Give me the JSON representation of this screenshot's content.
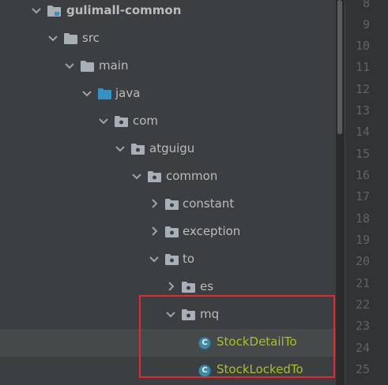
{
  "tree": {
    "nodes": [
      {
        "label": "gulimall-common",
        "expanded": true,
        "icon": "module-folder-icon",
        "bold": true
      },
      {
        "label": "src",
        "expanded": true,
        "icon": "folder-icon"
      },
      {
        "label": "main",
        "expanded": true,
        "icon": "folder-icon"
      },
      {
        "label": "java",
        "expanded": true,
        "icon": "source-root-folder-icon"
      },
      {
        "label": "com",
        "expanded": true,
        "icon": "package-icon"
      },
      {
        "label": "atguigu",
        "expanded": true,
        "icon": "package-icon"
      },
      {
        "label": "common",
        "expanded": true,
        "icon": "package-icon"
      },
      {
        "label": "constant",
        "expanded": false,
        "icon": "package-icon"
      },
      {
        "label": "exception",
        "expanded": false,
        "icon": "package-icon"
      },
      {
        "label": "to",
        "expanded": true,
        "icon": "package-icon"
      },
      {
        "label": "es",
        "expanded": false,
        "icon": "package-icon"
      },
      {
        "label": "mq",
        "expanded": true,
        "icon": "package-icon"
      },
      {
        "label": "StockDetailTo",
        "icon": "class-icon",
        "selected": true
      },
      {
        "label": "StockLockedTo",
        "icon": "class-icon"
      }
    ]
  },
  "class_icon_letter": "C",
  "line_numbers": [
    "8",
    "9",
    "10",
    "11",
    "12",
    "13",
    "14",
    "15",
    "16",
    "17",
    "18",
    "19",
    "20",
    "21",
    "22",
    "23",
    "24",
    "25"
  ],
  "colors": {
    "tree_bg": "#3c3f41",
    "editor_bg": "#2b2b2b",
    "text": "#bbbbbb",
    "class_text": "#a8c023",
    "highlight": "#45494a",
    "callout": "#e8272f",
    "source_folder": "#3592c4"
  }
}
